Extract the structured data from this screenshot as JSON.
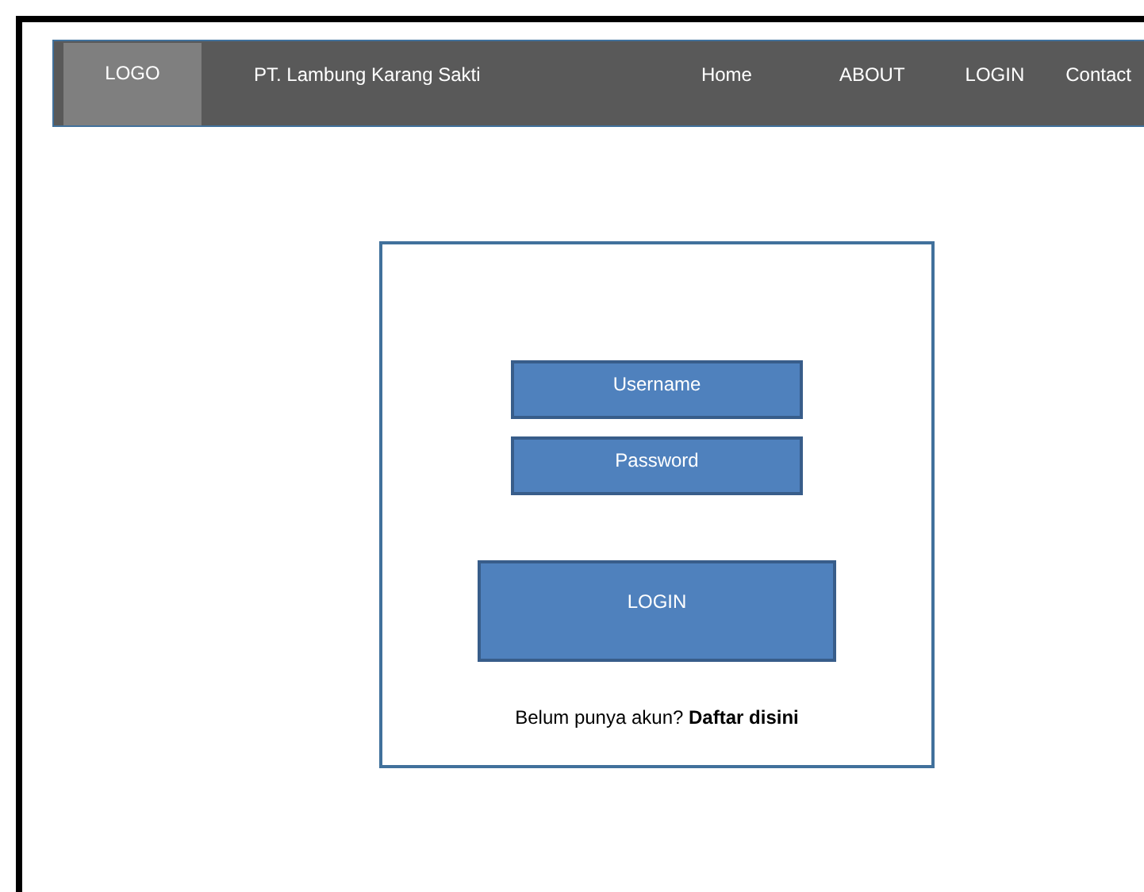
{
  "navbar": {
    "logo": "LOGO",
    "company": "PT. Lambung Karang Sakti",
    "links": [
      "Home",
      "ABOUT",
      "LOGIN",
      "Contact"
    ]
  },
  "login": {
    "fields": [
      {
        "placeholder": "Username"
      },
      {
        "placeholder": "Password"
      }
    ],
    "button": "LOGIN",
    "signup": "Belum punya akun? **Daftar disini**"
  }
}
